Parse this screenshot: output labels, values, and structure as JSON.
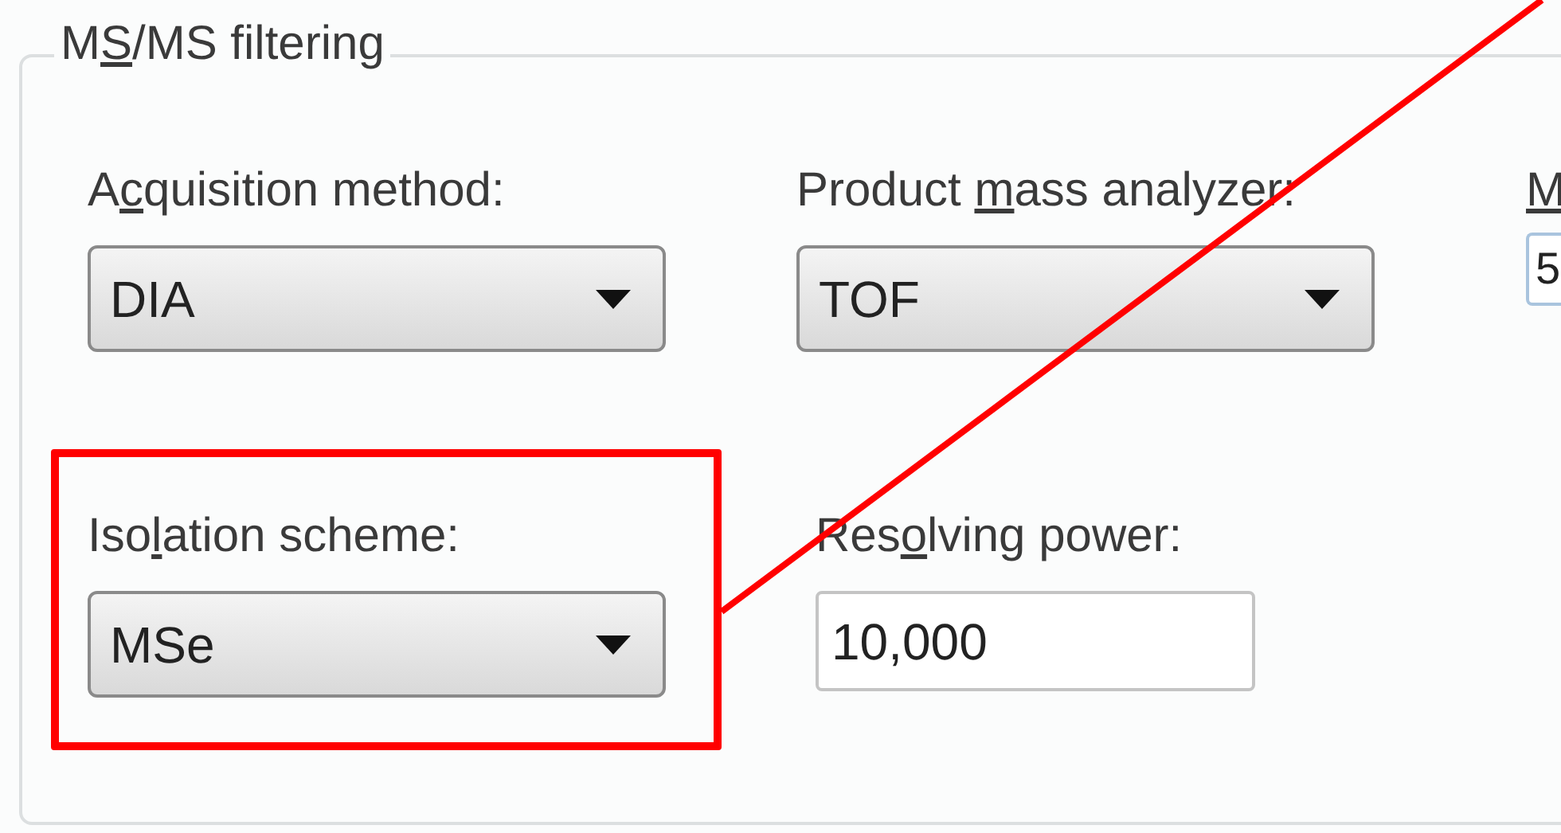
{
  "group": {
    "title": {
      "before": "M",
      "key": "S",
      "after": "/MS filtering"
    },
    "fields": [
      {
        "kind": "dropdown",
        "label": {
          "before": "A",
          "key": "c",
          "after": "quisition method:"
        },
        "value": "DIA"
      },
      {
        "kind": "dropdown",
        "label": {
          "before": "Product ",
          "key": "m",
          "after": "ass analyzer:"
        },
        "value": "TOF"
      },
      {
        "kind": "textbox",
        "label": {
          "key": "M"
        },
        "value": "5"
      },
      {
        "kind": "dropdown",
        "label": {
          "before": "Iso",
          "key": "l",
          "after": "ation scheme:"
        },
        "value": "MSe"
      },
      {
        "kind": "textbox",
        "label": {
          "before": "Res",
          "key": "o",
          "after": "lving power:"
        },
        "value": "10,000"
      }
    ]
  }
}
